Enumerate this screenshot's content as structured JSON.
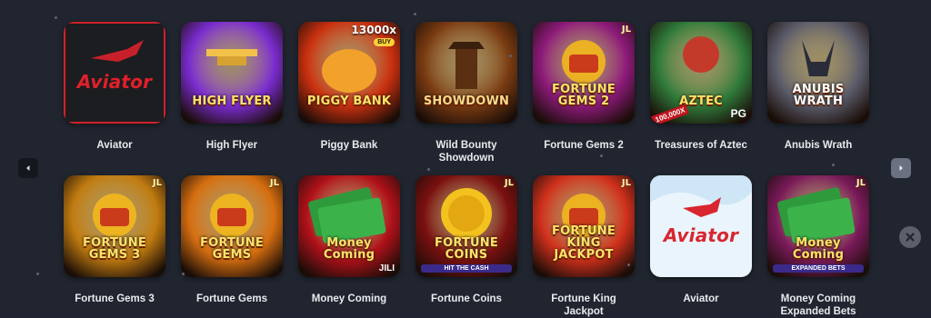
{
  "games": [
    {
      "title": "Aviator",
      "logo": "Aviator",
      "theme": "aviator-dark",
      "bg": "#1b1c1f",
      "logo_color": "#e0202a"
    },
    {
      "title": "High Flyer",
      "logo": "HIGH FLYER",
      "theme": "high-flyer",
      "bg": "#7a2ccf",
      "logo_color": "#ffe36a"
    },
    {
      "title": "Piggy Bank",
      "logo": "PIGGY BANK",
      "theme": "piggy",
      "bg": "#c9300f",
      "logo_color": "#ffe36a",
      "badge": "13000x",
      "buy": "BUY"
    },
    {
      "title": "Wild Bounty Showdown",
      "logo": "SHOWDOWN",
      "theme": "western",
      "bg": "#7a3b12",
      "logo_color": "#ffd88a"
    },
    {
      "title": "Fortune Gems 2",
      "logo": "FORTUNE GEMS 2",
      "theme": "gems",
      "bg": "#8d1a7a",
      "logo_color": "#ffe36a",
      "jl": "JL"
    },
    {
      "title": "Treasures of Aztec",
      "logo": "AZTEC",
      "theme": "aztec",
      "bg": "#2f7a3a",
      "logo_color": "#ffe36a",
      "pg": "PG",
      "multiplier": "100,000X"
    },
    {
      "title": "Anubis Wrath",
      "logo": "ANUBIS WRATH",
      "theme": "anubis",
      "bg": "#5a5b6a",
      "logo_color": "#ffffff"
    },
    {
      "title": "Fortune Gems 3",
      "logo": "FORTUNE GEMS 3",
      "theme": "gems3",
      "bg": "#c07b10",
      "logo_color": "#ffe36a",
      "jl": "JL"
    },
    {
      "title": "Fortune Gems",
      "logo": "FORTUNE GEMS",
      "theme": "gems1",
      "bg": "#d56e10",
      "logo_color": "#ffe36a",
      "jl": "JL"
    },
    {
      "title": "Money Coming",
      "logo": "Money Coming",
      "theme": "money",
      "bg": "#b0111a",
      "logo_color": "#ffe36a",
      "brand": "JILI"
    },
    {
      "title": "Fortune Coins",
      "logo": "FORTUNE COINS",
      "theme": "coins",
      "bg": "#7a1010",
      "logo_color": "#ffe36a",
      "jl": "JL",
      "sub": "HIT THE CASH"
    },
    {
      "title": "Fortune King Jackpot",
      "logo": "FORTUNE KING JACKPOT",
      "theme": "king",
      "bg": "#d0301c",
      "logo_color": "#ffe36a",
      "jl": "JL"
    },
    {
      "title": "Aviator",
      "logo": "Aviator",
      "theme": "aviator-light",
      "bg": "#e9f3fb",
      "logo_color": "#d8262f"
    },
    {
      "title": "Money Coming Expanded Bets",
      "logo": "Money Coming",
      "theme": "money2",
      "bg": "#7a1a5a",
      "logo_color": "#ffe36a",
      "jl": "JL",
      "sub": "EXPANDED BETS"
    }
  ],
  "nav": {
    "prev_icon": "chevron-left-icon",
    "next_icon": "chevron-right-icon",
    "close_icon": "close-icon"
  }
}
